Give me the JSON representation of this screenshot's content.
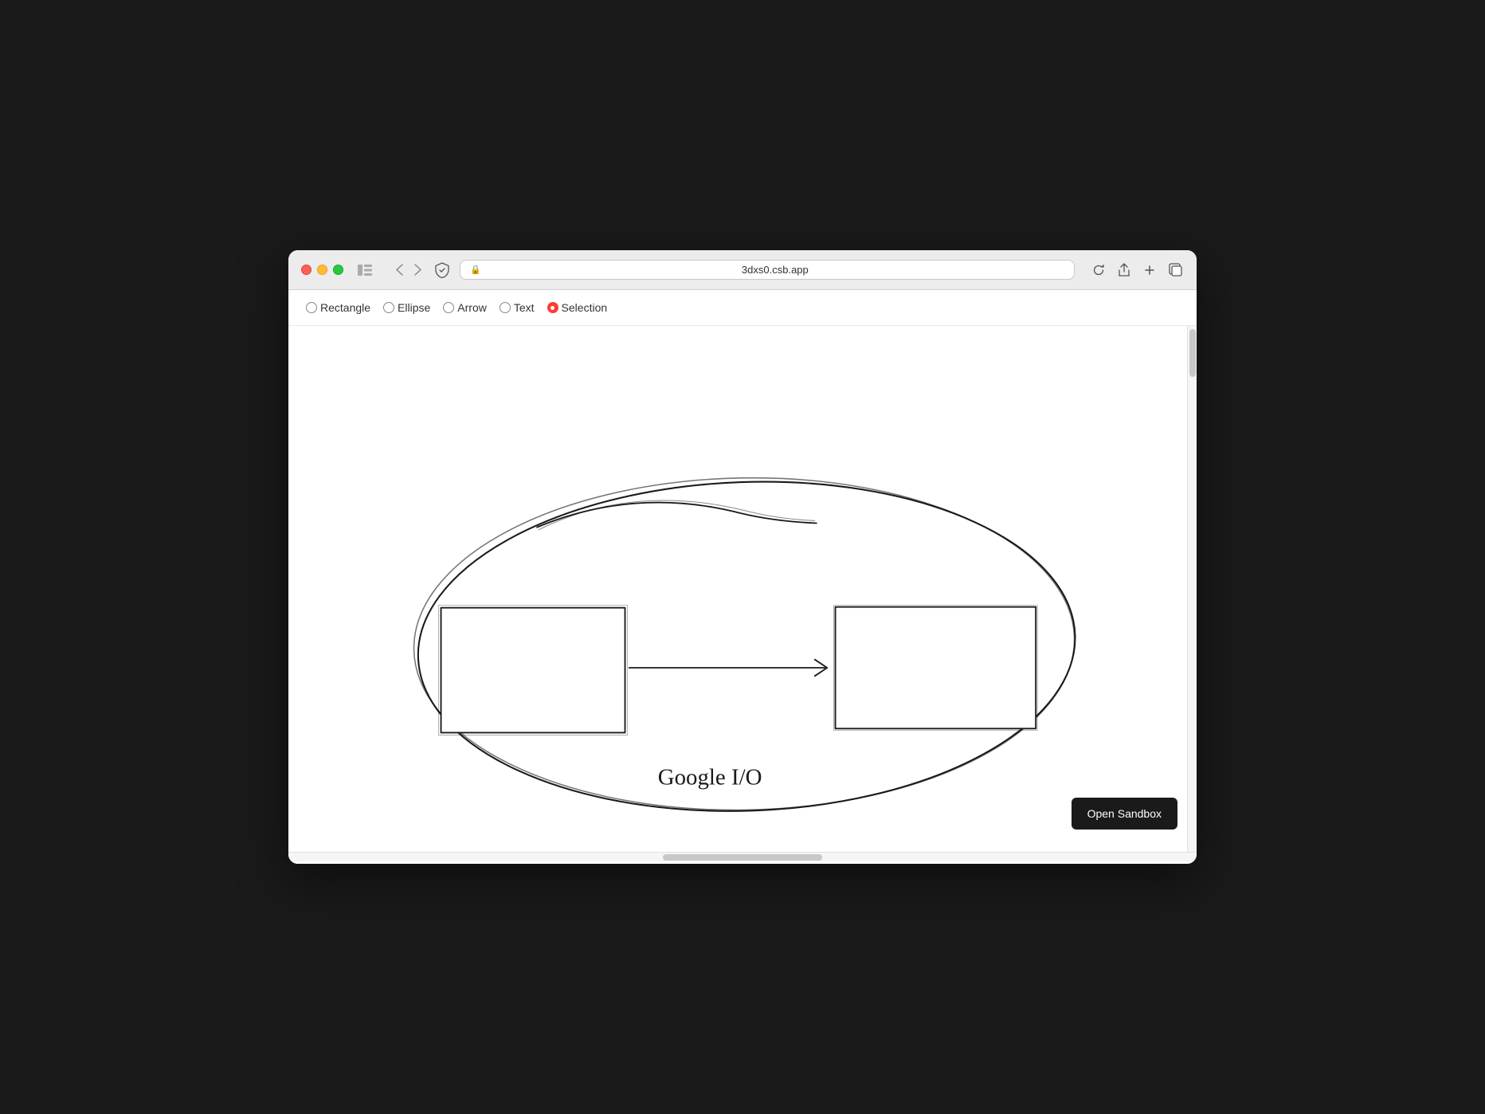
{
  "browser": {
    "url": "3dxs0.csb.app",
    "traffic_lights": [
      "close",
      "minimize",
      "maximize"
    ]
  },
  "toolbar": {
    "tools": [
      {
        "id": "rectangle",
        "label": "Rectangle",
        "selected": false
      },
      {
        "id": "ellipse",
        "label": "Ellipse",
        "selected": false
      },
      {
        "id": "arrow",
        "label": "Arrow",
        "selected": false
      },
      {
        "id": "text",
        "label": "Text",
        "selected": false
      },
      {
        "id": "selection",
        "label": "Selection",
        "selected": true
      }
    ]
  },
  "canvas": {
    "drawing_label": "Google I/O"
  },
  "buttons": {
    "open_sandbox": "Open Sandbox"
  }
}
